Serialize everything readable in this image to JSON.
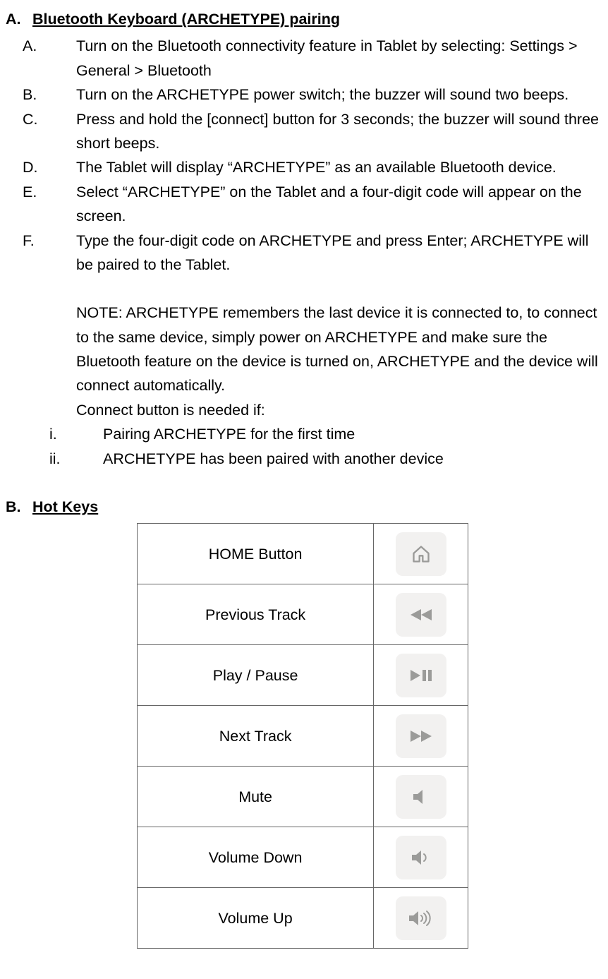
{
  "sectionA": {
    "marker": "A.",
    "title": "Bluetooth Keyboard (ARCHETYPE) pairing",
    "steps": [
      {
        "marker": "A.",
        "text": "Turn on the Bluetooth connectivity feature in Tablet by selecting: Settings > General > Bluetooth"
      },
      {
        "marker": "B.",
        "text": "Turn on the ARCHETYPE power switch; the buzzer will sound two beeps."
      },
      {
        "marker": "C.",
        "text": "Press and hold the [connect] button for 3 seconds; the buzzer will sound three short beeps."
      },
      {
        "marker": "D.",
        "text": "The Tablet will display “ARCHETYPE” as an available Bluetooth device."
      },
      {
        "marker": "E.",
        "text": "Select “ARCHETYPE” on the Tablet and a four-digit code will appear on the screen."
      },
      {
        "marker": "F.",
        "text": "Type the four-digit code on ARCHETYPE and press Enter; ARCHETYPE will be paired to the Tablet."
      }
    ],
    "note1": "NOTE: ARCHETYPE remembers the last device it is connected to, to connect to the same device, simply power on ARCHETYPE and make sure the Bluetooth feature on the device is turned on, ARCHETYPE and the device will connect automatically.",
    "note2": "Connect button is needed if:",
    "subSteps": [
      {
        "marker": "i.",
        "text": "Pairing ARCHETYPE for the first time"
      },
      {
        "marker": "ii.",
        "text": "ARCHETYPE has been paired with another device"
      }
    ]
  },
  "sectionB": {
    "marker": "B.",
    "title": "Hot Keys",
    "rows": [
      {
        "label": "HOME Button",
        "icon": "home-icon"
      },
      {
        "label": "Previous Track",
        "icon": "previous-track-icon"
      },
      {
        "label": "Play / Pause",
        "icon": "play-pause-icon"
      },
      {
        "label": "Next Track",
        "icon": "next-track-icon"
      },
      {
        "label": "Mute",
        "icon": "mute-icon"
      },
      {
        "label": "Volume Down",
        "icon": "volume-down-icon"
      },
      {
        "label": "Volume Up",
        "icon": "volume-up-icon"
      }
    ]
  }
}
